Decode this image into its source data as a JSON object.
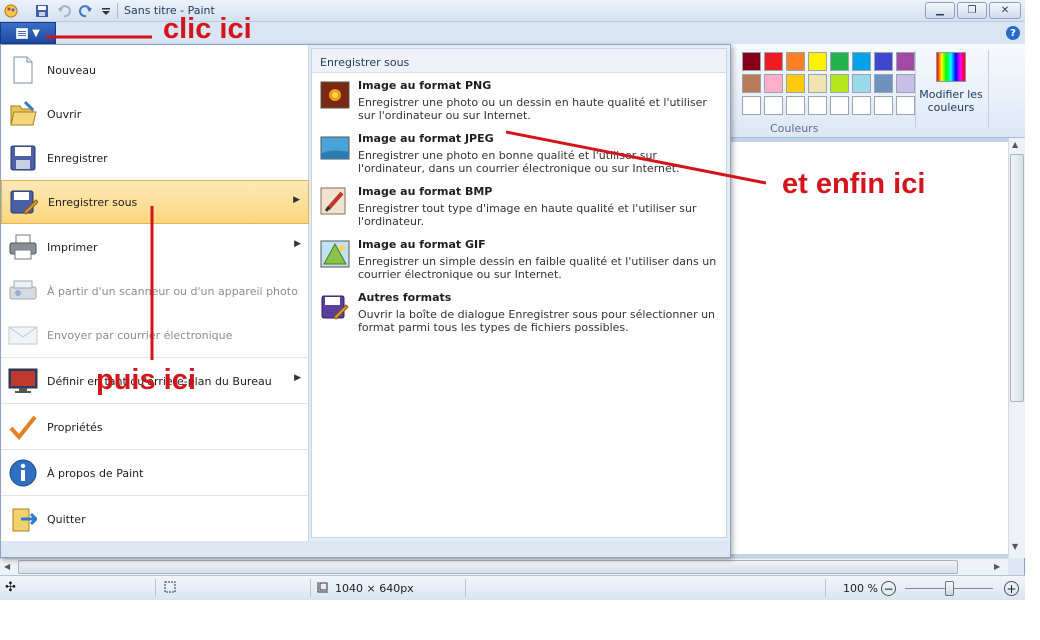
{
  "window": {
    "title": "Sans titre - Paint",
    "minimize": "minimize-icon",
    "maximize": "maximize-icon",
    "close": "close-icon"
  },
  "ribbon": {
    "colors_label": "Couleurs",
    "edit_colors_label": "Modifier les couleurs",
    "palette_row1": [
      "#880015",
      "#ed1c24",
      "#ff7f27",
      "#fff200",
      "#22b14c",
      "#00a2e8",
      "#3f48cc",
      "#a349a4"
    ],
    "palette_row2": [
      "#b97a57",
      "#ffaec9",
      "#ffc90e",
      "#efe4b0",
      "#b5e61d",
      "#99d9ea",
      "#7092be",
      "#c8bfe7"
    ]
  },
  "file_menu": {
    "items": [
      {
        "label": "Nouveau",
        "icon": "new-document-icon",
        "enabled": true
      },
      {
        "label": "Ouvrir",
        "icon": "open-folder-icon",
        "enabled": true
      },
      {
        "label": "Enregistrer",
        "icon": "save-disk-icon",
        "enabled": true
      },
      {
        "label": "Enregistrer sous",
        "icon": "save-as-icon",
        "enabled": true,
        "selected": true,
        "submenu": true
      },
      {
        "label": "Imprimer",
        "icon": "printer-icon",
        "enabled": true,
        "submenu": true
      },
      {
        "label": "À partir d'un scanneur ou d'un appareil photo",
        "icon": "scanner-icon",
        "enabled": false
      },
      {
        "label": "Envoyer par courrier électronique",
        "icon": "email-icon",
        "enabled": false
      },
      {
        "label": "Définir en tant qu'arrière-plan du Bureau",
        "icon": "desktop-icon",
        "enabled": true,
        "submenu": true
      },
      {
        "label": "Propriétés",
        "icon": "checkmark-icon",
        "enabled": true
      },
      {
        "label": "À propos de Paint",
        "icon": "info-icon",
        "enabled": true
      },
      {
        "label": "Quitter",
        "icon": "exit-icon",
        "enabled": true
      }
    ],
    "submenu": {
      "heading": "Enregistrer sous",
      "entries": [
        {
          "title": "Image au format PNG",
          "desc": "Enregistrer une photo ou un dessin en haute qualité et l'utiliser sur l'ordinateur ou sur Internet.",
          "icon": "png-image-icon"
        },
        {
          "title": "Image au format JPEG",
          "desc": "Enregistrer une photo en bonne qualité et l'utiliser sur l'ordinateur, dans un courrier électronique ou sur Internet.",
          "icon": "jpeg-image-icon"
        },
        {
          "title": "Image au format BMP",
          "desc": "Enregistrer tout type d'image en haute qualité et l'utiliser sur l'ordinateur.",
          "icon": "bmp-image-icon"
        },
        {
          "title": "Image au format GIF",
          "desc": "Enregistrer un simple dessin en faible qualité et l'utiliser dans un courrier électronique ou sur Internet.",
          "icon": "gif-image-icon"
        },
        {
          "title": "Autres formats",
          "desc": "Ouvrir la boîte de dialogue Enregistrer sous pour sélectionner un format parmi tous les types de fichiers possibles.",
          "icon": "other-formats-icon"
        }
      ]
    }
  },
  "status": {
    "image_size": "1040 × 640px",
    "zoom": "100 %",
    "zoom_level": 0.5
  },
  "annotations": {
    "first": "clic ici",
    "second": "puis ici",
    "third": "et enfin ici",
    "color": "#d4141b"
  }
}
